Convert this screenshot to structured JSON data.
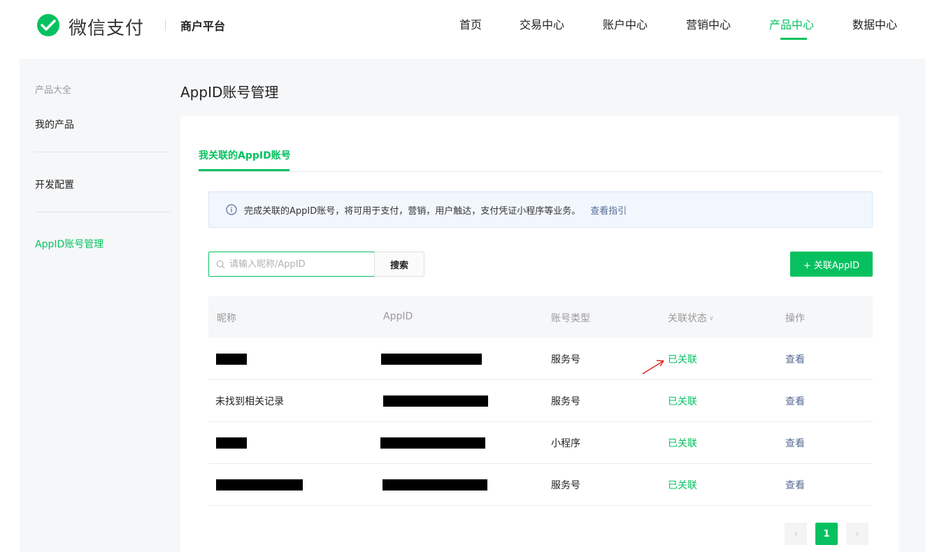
{
  "header": {
    "brand": "微信支付",
    "platform": "商户平台",
    "nav": [
      {
        "label": "首页",
        "active": false
      },
      {
        "label": "交易中心",
        "active": false
      },
      {
        "label": "账户中心",
        "active": false
      },
      {
        "label": "营销中心",
        "active": false
      },
      {
        "label": "产品中心",
        "active": true
      },
      {
        "label": "数据中心",
        "active": false
      }
    ]
  },
  "sidebar": {
    "group_title": "产品大全",
    "items": [
      {
        "label": "我的产品",
        "active": false
      },
      {
        "label": "开发配置",
        "active": false
      },
      {
        "label": "AppID账号管理",
        "active": true
      }
    ]
  },
  "main": {
    "title": "AppID账号管理",
    "tab": "我关联的AppID账号",
    "notice": {
      "icon": "info-icon",
      "text": "完成关联的AppID账号，将可用于支付，营销，用户触达，支付凭证小程序等业务。",
      "link": "查看指引"
    },
    "search": {
      "placeholder": "请输入昵称/AppID",
      "value": "",
      "button": "搜索"
    },
    "add_button": "+ 关联AppID",
    "table": {
      "columns": [
        "昵称",
        "AppID",
        "账号类型",
        "关联状态",
        "操作"
      ],
      "rows": [
        {
          "nickname": "",
          "nickname_redacted": true,
          "appid_redacted": true,
          "type": "服务号",
          "status": "已关联",
          "action": "查看"
        },
        {
          "nickname": "未找到相关记录",
          "nickname_redacted": false,
          "appid_redacted": true,
          "type": "服务号",
          "status": "已关联",
          "action": "查看"
        },
        {
          "nickname": "",
          "nickname_redacted": true,
          "appid_redacted": true,
          "type": "小程序",
          "status": "已关联",
          "action": "查看"
        },
        {
          "nickname": "",
          "nickname_redacted": true,
          "appid_redacted": true,
          "type": "服务号",
          "status": "已关联",
          "action": "查看"
        }
      ]
    },
    "pagination": {
      "prev": "‹",
      "current": "1",
      "next": "›"
    }
  },
  "colors": {
    "accent": "#07c160",
    "link": "#576b95",
    "annotation": "#e02020"
  }
}
